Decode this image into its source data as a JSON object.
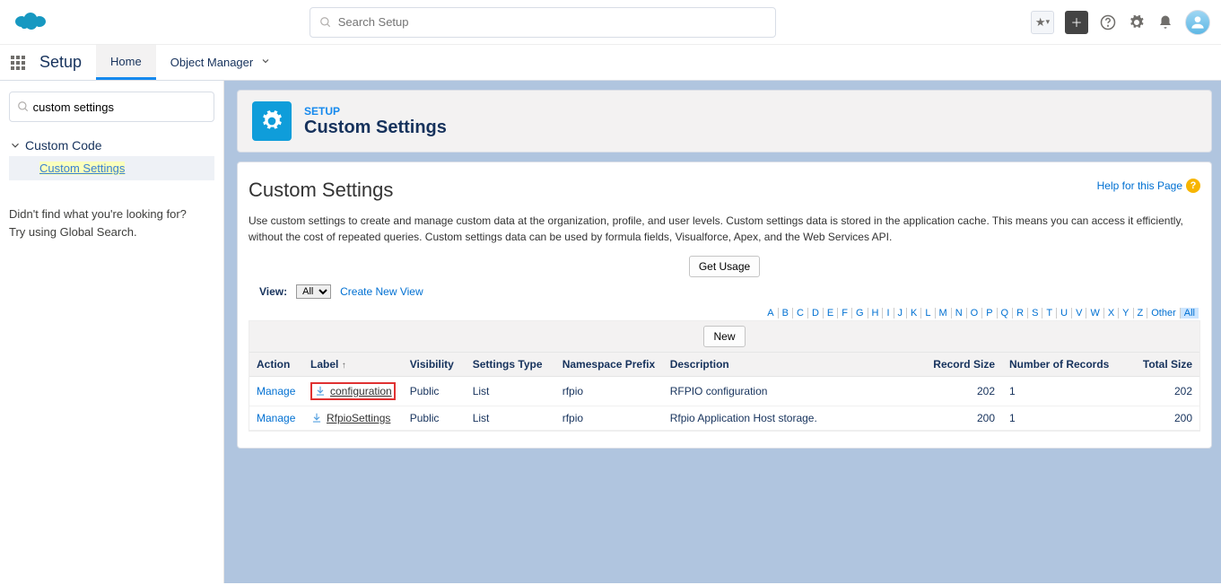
{
  "header": {
    "search_placeholder": "Search Setup"
  },
  "nav": {
    "app": "Setup",
    "tabs": [
      "Home",
      "Object Manager"
    ],
    "active_tab": 0
  },
  "sidebar": {
    "quickfind": "custom settings",
    "section": "Custom Code",
    "item": "Custom Settings",
    "nofind_line1": "Didn't find what you're looking for?",
    "nofind_line2": "Try using Global Search."
  },
  "page": {
    "breadcrumb": "SETUP",
    "title": "Custom Settings"
  },
  "content": {
    "title": "Custom Settings",
    "help_label": "Help for this Page",
    "description": "Use custom settings to create and manage custom data at the organization, profile, and user levels. Custom settings data is stored in the application cache. This means you can access it efficiently, without the cost of repeated queries. Custom settings data can be used by formula fields, Visualforce, Apex, and the Web Services API.",
    "get_usage": "Get Usage",
    "view_label": "View:",
    "view_value": "All",
    "create_view": "Create New View",
    "new_button": "New",
    "alpha": [
      "A",
      "B",
      "C",
      "D",
      "E",
      "F",
      "G",
      "H",
      "I",
      "J",
      "K",
      "L",
      "M",
      "N",
      "O",
      "P",
      "Q",
      "R",
      "S",
      "T",
      "U",
      "V",
      "W",
      "X",
      "Y",
      "Z",
      "Other",
      "All"
    ]
  },
  "table": {
    "headers": {
      "action": "Action",
      "label": "Label",
      "visibility": "Visibility",
      "settings_type": "Settings Type",
      "namespace": "Namespace Prefix",
      "description": "Description",
      "record_size": "Record Size",
      "num_records": "Number of Records",
      "total_size": "Total Size"
    },
    "rows": [
      {
        "action": "Manage",
        "label": "configuration",
        "visibility": "Public",
        "settings_type": "List",
        "namespace": "rfpio",
        "description": "RFPIO configuration",
        "record_size": "202",
        "num_records": "1",
        "total_size": "202",
        "highlight": true
      },
      {
        "action": "Manage",
        "label": "RfpioSettings",
        "visibility": "Public",
        "settings_type": "List",
        "namespace": "rfpio",
        "description": "Rfpio Application Host storage.",
        "record_size": "200",
        "num_records": "1",
        "total_size": "200",
        "highlight": false
      }
    ]
  }
}
